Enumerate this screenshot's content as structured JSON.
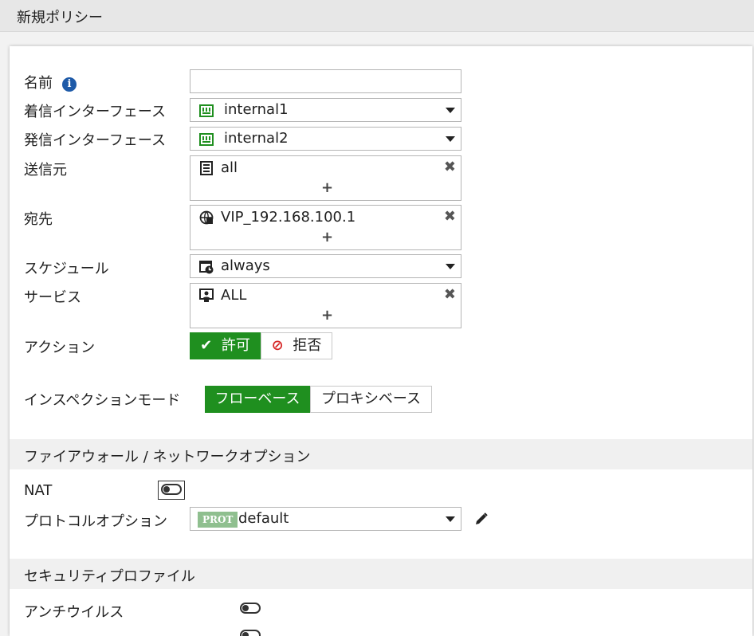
{
  "window": {
    "title": "新規ポリシー"
  },
  "form": {
    "name": {
      "label": "名前",
      "value": ""
    },
    "incoming": {
      "label": "着信インターフェース",
      "value": "internal1",
      "icon": "interface-port-icon"
    },
    "outgoing": {
      "label": "発信インターフェース",
      "value": "internal2",
      "icon": "interface-port-icon"
    },
    "source": {
      "label": "送信元",
      "value": "all",
      "icon": "address-icon"
    },
    "destination": {
      "label": "宛先",
      "value": "VIP_192.168.100.1",
      "icon": "vip-globe-icon"
    },
    "schedule": {
      "label": "スケジュール",
      "value": "always",
      "icon": "schedule-clock-icon"
    },
    "service": {
      "label": "サービス",
      "value": "ALL",
      "icon": "service-monitor-icon"
    },
    "action": {
      "label": "アクション",
      "accept": "許可",
      "deny": "拒否",
      "selected": "accept"
    },
    "inspection": {
      "label": "インスペクションモード",
      "flow": "フローベース",
      "proxy": "プロキシベース",
      "selected": "flow"
    }
  },
  "firewall_section": {
    "title": "ファイアウォール / ネットワークオプション",
    "nat": {
      "label": "NAT",
      "enabled": false
    },
    "protocol_options": {
      "label": "プロトコルオプション",
      "badge": "PROT",
      "value": "default"
    }
  },
  "security_section": {
    "title": "セキュリティプロファイル",
    "antivirus": {
      "label": "アンチウイルス",
      "enabled": false
    }
  },
  "colors": {
    "accent_green": "#1f8f1f",
    "deny_red": "#d62828",
    "prot_badge": "#8fbf8f"
  }
}
